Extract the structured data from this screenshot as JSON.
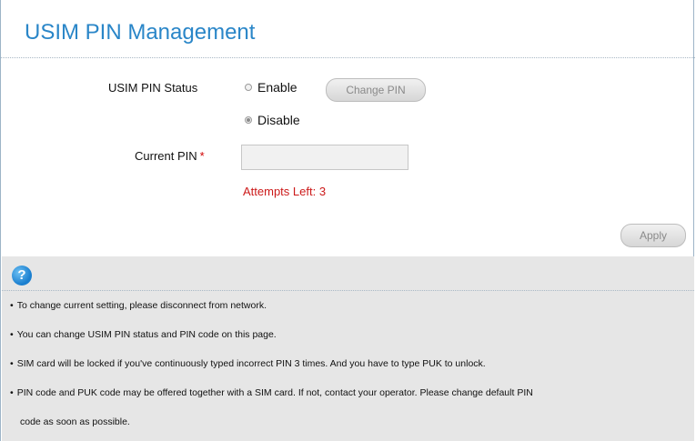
{
  "page": {
    "title": "USIM PIN Management"
  },
  "form": {
    "status_label": "USIM PIN Status",
    "enable_label": "Enable",
    "disable_label": "Disable",
    "selected": "disable",
    "change_pin_label": "Change PIN",
    "current_pin_label": "Current PIN",
    "required_marker": "*",
    "current_pin_value": "",
    "attempts_text": "Attempts Left: 3",
    "apply_label": "Apply"
  },
  "help": {
    "icon": "help-icon",
    "icon_glyph": "?",
    "bullet": "•",
    "lines": [
      "To change current setting, please disconnect from network.",
      "You can change USIM PIN status and PIN code on this page.",
      "SIM card will be locked if you've continuously typed incorrect PIN 3 times. And you have to type PUK to unlock.",
      "PIN code and PUK code may be offered together with a SIM card. If not, contact your operator. Please change default PIN",
      "code as soon as possible."
    ]
  },
  "colors": {
    "title_blue": "#2a86c8",
    "error_red": "#cc1a1a",
    "help_background": "#e6e6e6"
  }
}
